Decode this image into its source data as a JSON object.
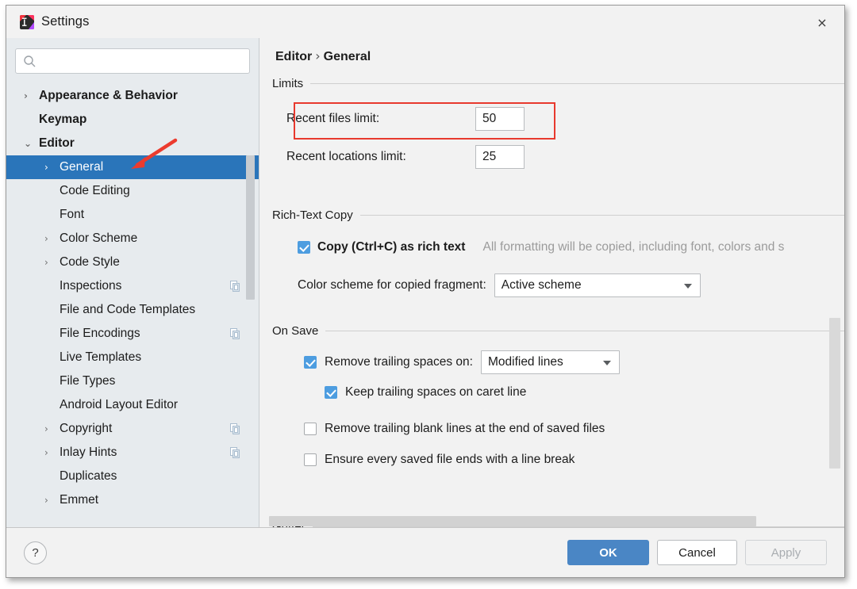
{
  "window": {
    "title": "Settings",
    "app_icon": "intellij-settings-icon",
    "close_label": "×"
  },
  "sidebar": {
    "search": {
      "value": "",
      "placeholder": "",
      "icon": "search-icon"
    },
    "items": [
      {
        "label": "Appearance & Behavior",
        "level": 0,
        "arrow": "›",
        "expanded": false,
        "selected": false,
        "dup_icon": false
      },
      {
        "label": "Keymap",
        "level": 0,
        "arrow": "",
        "expanded": false,
        "selected": false,
        "dup_icon": false
      },
      {
        "label": "Editor",
        "level": 0,
        "arrow": "⌄",
        "expanded": true,
        "selected": false,
        "dup_icon": false
      },
      {
        "label": "General",
        "level": 1,
        "arrow": "›",
        "expanded": false,
        "selected": true,
        "dup_icon": false
      },
      {
        "label": "Code Editing",
        "level": 1,
        "arrow": "",
        "expanded": false,
        "selected": false,
        "dup_icon": false
      },
      {
        "label": "Font",
        "level": 1,
        "arrow": "",
        "expanded": false,
        "selected": false,
        "dup_icon": false
      },
      {
        "label": "Color Scheme",
        "level": 1,
        "arrow": "›",
        "expanded": false,
        "selected": false,
        "dup_icon": false
      },
      {
        "label": "Code Style",
        "level": 1,
        "arrow": "›",
        "expanded": false,
        "selected": false,
        "dup_icon": false
      },
      {
        "label": "Inspections",
        "level": 1,
        "arrow": "",
        "expanded": false,
        "selected": false,
        "dup_icon": true
      },
      {
        "label": "File and Code Templates",
        "level": 1,
        "arrow": "",
        "expanded": false,
        "selected": false,
        "dup_icon": false
      },
      {
        "label": "File Encodings",
        "level": 1,
        "arrow": "",
        "expanded": false,
        "selected": false,
        "dup_icon": true
      },
      {
        "label": "Live Templates",
        "level": 1,
        "arrow": "",
        "expanded": false,
        "selected": false,
        "dup_icon": false
      },
      {
        "label": "File Types",
        "level": 1,
        "arrow": "",
        "expanded": false,
        "selected": false,
        "dup_icon": false
      },
      {
        "label": "Android Layout Editor",
        "level": 1,
        "arrow": "",
        "expanded": false,
        "selected": false,
        "dup_icon": false
      },
      {
        "label": "Copyright",
        "level": 1,
        "arrow": "›",
        "expanded": false,
        "selected": false,
        "dup_icon": true
      },
      {
        "label": "Inlay Hints",
        "level": 1,
        "arrow": "›",
        "expanded": false,
        "selected": false,
        "dup_icon": true
      },
      {
        "label": "Duplicates",
        "level": 1,
        "arrow": "",
        "expanded": false,
        "selected": false,
        "dup_icon": false
      },
      {
        "label": "Emmet",
        "level": 1,
        "arrow": "›",
        "expanded": false,
        "selected": false,
        "dup_icon": false
      }
    ]
  },
  "content": {
    "breadcrumb": {
      "parent": "Editor",
      "separator": "›",
      "current": "General"
    },
    "limits": {
      "title": "Limits",
      "recent_files_label": "Recent files limit:",
      "recent_files_value": "50",
      "recent_locations_label": "Recent locations limit:",
      "recent_locations_value": "25"
    },
    "rich_text_copy": {
      "title": "Rich-Text Copy",
      "copy_checkbox_label": "Copy (Ctrl+C) as rich text",
      "copy_checkbox_checked": true,
      "copy_hint": "All formatting will be copied, including font, colors and s",
      "color_scheme_label": "Color scheme for copied fragment:",
      "color_scheme_value": "Active scheme"
    },
    "on_save": {
      "title": "On Save",
      "remove_trailing_spaces_label": "Remove trailing spaces on:",
      "remove_trailing_spaces_checked": true,
      "remove_trailing_spaces_value": "Modified lines",
      "keep_trailing_spaces_label": "Keep trailing spaces on caret line",
      "keep_trailing_spaces_checked": true,
      "remove_blank_lines_label": "Remove trailing blank lines at the end of saved files",
      "remove_blank_lines_checked": false,
      "ensure_line_break_label": "Ensure every saved file ends with a line break",
      "ensure_line_break_checked": false
    },
    "gutter": {
      "title": "Gutter"
    }
  },
  "footer": {
    "help_label": "?",
    "ok_label": "OK",
    "cancel_label": "Cancel",
    "apply_label": "Apply"
  },
  "annotations": {
    "red_box_target": "Recent files limit row",
    "red_arrow_target": "General tree item"
  },
  "colors": {
    "selection_blue": "#2a75ba",
    "checkbox_blue": "#4d9de0",
    "ok_button_blue": "#4a86c5",
    "annotation_red": "#e8392e",
    "sidebar_bg": "#e7ebee",
    "content_bg": "#f2f2f2"
  }
}
